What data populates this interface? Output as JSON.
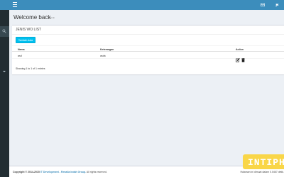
{
  "topbar": {
    "color": "#3c8dbc",
    "menu_icon": "hamburger-icon",
    "right_icons": [
      "envelope-icon",
      "flag-icon"
    ]
  },
  "sidebar": {
    "color": "#222d32",
    "search_icon": "search-icon"
  },
  "header": {
    "title": "Welcome back",
    "subtitle": "admin"
  },
  "box": {
    "title": "JENIS WO LIST",
    "add_button": "Tambah data"
  },
  "table": {
    "columns": [
      "Nama",
      "Keterangan",
      "Action"
    ],
    "rows": [
      {
        "nama": "asd",
        "keterangan": "asda",
        "actions": [
          "edit-icon",
          "trash-icon"
        ]
      }
    ],
    "info": "Showing 1 to 1 of 1 entries"
  },
  "footer": {
    "copyright_prefix": "Copyright © 2014-2015 ",
    "company": "IT Development - Renalia Indah Group.",
    "rights": " All rights reserved.",
    "render_time": "Halaman ini dimuat dalam 0.0467 detik."
  },
  "watermark": {
    "text": "INTIPH",
    "color": "#f9d648"
  }
}
